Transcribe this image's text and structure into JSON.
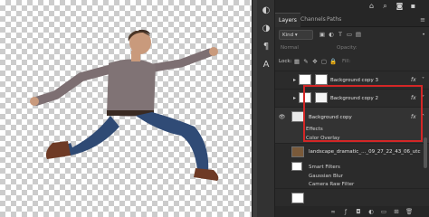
{
  "tabs": [
    {
      "label": "Layers",
      "active": true
    },
    {
      "label": "Channels",
      "active": false
    },
    {
      "label": "Paths",
      "active": false
    }
  ],
  "filter": {
    "kind_label": "Kind"
  },
  "controls": {
    "mode": "Normal",
    "opacity_label": "Opacity:",
    "lock_label": "Lock:",
    "fill_label": "Fill:"
  },
  "layers": [
    {
      "name": "Background copy 3",
      "visible": false,
      "fx": true
    },
    {
      "name": "Background copy 2",
      "visible": false,
      "fx": true
    },
    {
      "name": "Background copy",
      "visible": true,
      "fx": true,
      "effects_label": "Effects",
      "effects": [
        "Color Overlay"
      ]
    },
    {
      "name": "landscape_dramatic_..._09_27_22_43_06_utc",
      "visible": false,
      "fx": false,
      "smart_filters_label": "Smart Filters",
      "filters": [
        "Gaussian Blur",
        "Camera Raw Filter"
      ]
    },
    {
      "name": "",
      "visible": false,
      "fx": false
    }
  ],
  "colors": {
    "highlight": "#d42626",
    "canvas_checker": "#cccccc"
  },
  "icons": [
    "home-icon",
    "search-icon",
    "camera-icon",
    "more-icon",
    "eye-icon",
    "fx-icon",
    "lock-icon",
    "filter-icon"
  ]
}
